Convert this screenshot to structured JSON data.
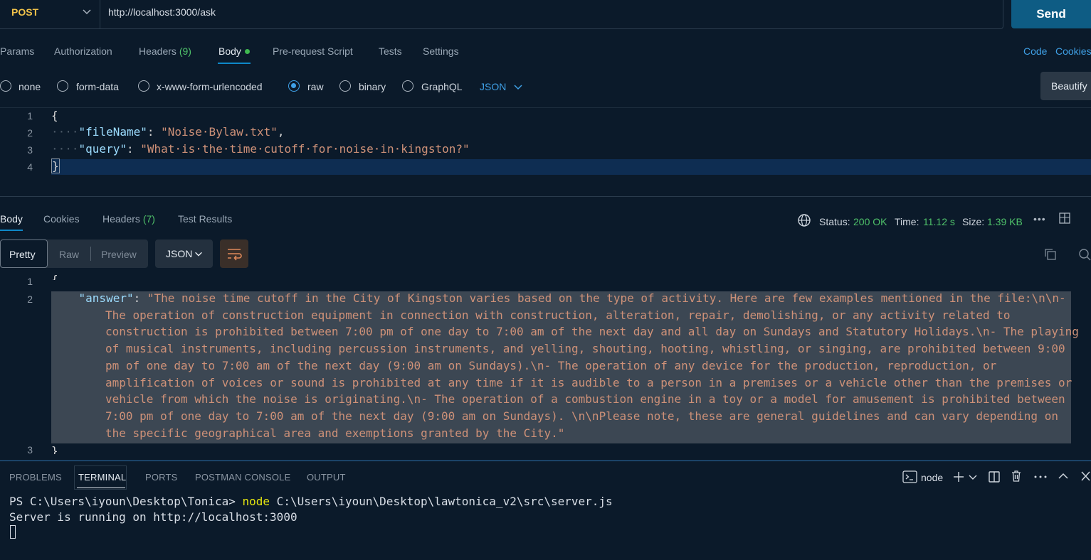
{
  "request": {
    "method": "POST",
    "url": "http://localhost:3000/ask",
    "send_label": "Send"
  },
  "request_tabs": {
    "params": "Params",
    "authorization": "Authorization",
    "headers": "Headers",
    "headers_count": "(9)",
    "body": "Body",
    "prerequest": "Pre-request Script",
    "tests": "Tests",
    "settings": "Settings",
    "code": "Code",
    "cookies": "Cookies"
  },
  "body_types": {
    "none": "none",
    "form_data": "form-data",
    "urlencoded": "x-www-form-urlencoded",
    "raw": "raw",
    "binary": "binary",
    "graphql": "GraphQL",
    "selected": "raw",
    "format": "JSON",
    "beautify": "Beautify"
  },
  "editor": {
    "line_numbers": [
      "1",
      "2",
      "3",
      "4"
    ],
    "open_brace": "{",
    "close_brace": "}",
    "indent": "····",
    "key1": "\"fileName\"",
    "val1": "\"Noise·Bylaw.txt\"",
    "key2": "\"query\"",
    "val2": "\"What·is·the·time·cutoff·for·noise·in·kingston?\""
  },
  "response_tabs": {
    "body": "Body",
    "cookies": "Cookies",
    "headers": "Headers",
    "headers_count": "(7)",
    "test_results": "Test Results"
  },
  "status": {
    "status_label": "Status:",
    "status_value": "200 OK",
    "time_label": "Time:",
    "time_value": "11.12 s",
    "size_label": "Size:",
    "size_value": "1.39 KB",
    "more": "•••"
  },
  "view": {
    "pretty": "Pretty",
    "raw": "Raw",
    "preview": "Preview",
    "format": "JSON"
  },
  "response": {
    "line_numbers": [
      "1",
      "2",
      "3"
    ],
    "open_brace": "{",
    "close_brace": "}",
    "key": "\"answer\"",
    "lines": [
      "\"The noise time cutoff in the City of Kingston varies based on the type of activity. Here are few examples mentioned in the file:\\n\\n-",
      "The operation of construction equipment in connection with construction, alteration, repair, demolishing, or any activity related to",
      "construction is prohibited between 7:00 pm of one day to 7:00 am of the next day and all day on Sundays and Statutory Holidays.\\n- The playing",
      "of musical instruments, including percussion instruments, and yelling, shouting, hooting, whistling, or singing, are prohibited between 9:00",
      "pm of one day to 7:00 am of the next day (9:00 am on Sundays).\\n- The operation of any device for the production, reproduction, or",
      "amplification of voices or sound is prohibited at any time if it is audible to a person in a premises or a vehicle other than the premises or",
      "vehicle from which the noise is originating.\\n- The operation of a combustion engine in a toy or a model for amusement is prohibited between",
      "7:00 pm of one day to 7:00 am of the next day (9:00 am on Sundays). \\n\\nPlease note, these are general guidelines and can vary depending on",
      "the specific geographical area and exemptions granted by the City.\""
    ]
  },
  "panel": {
    "tabs": [
      "PROBLEMS",
      "TERMINAL",
      "PORTS",
      "POSTMAN CONSOLE",
      "OUTPUT"
    ],
    "active_tab": "TERMINAL",
    "shell_label": "node"
  },
  "terminal": {
    "prompt": "PS C:\\Users\\iyoun\\Desktop\\Tonica> ",
    "command": "node",
    "args": " C:\\Users\\iyoun\\Desktop\\lawtonica_v2\\src\\server.js",
    "output": "Server is running on http://localhost:3000"
  },
  "colors": {
    "background": "#0b1a2a",
    "accent": "#0e88c8",
    "send_button": "#0e5c84",
    "method": "#f0c24a",
    "success": "#4fc26a",
    "json_key": "#9cdcfe",
    "json_string": "#ce9178"
  }
}
